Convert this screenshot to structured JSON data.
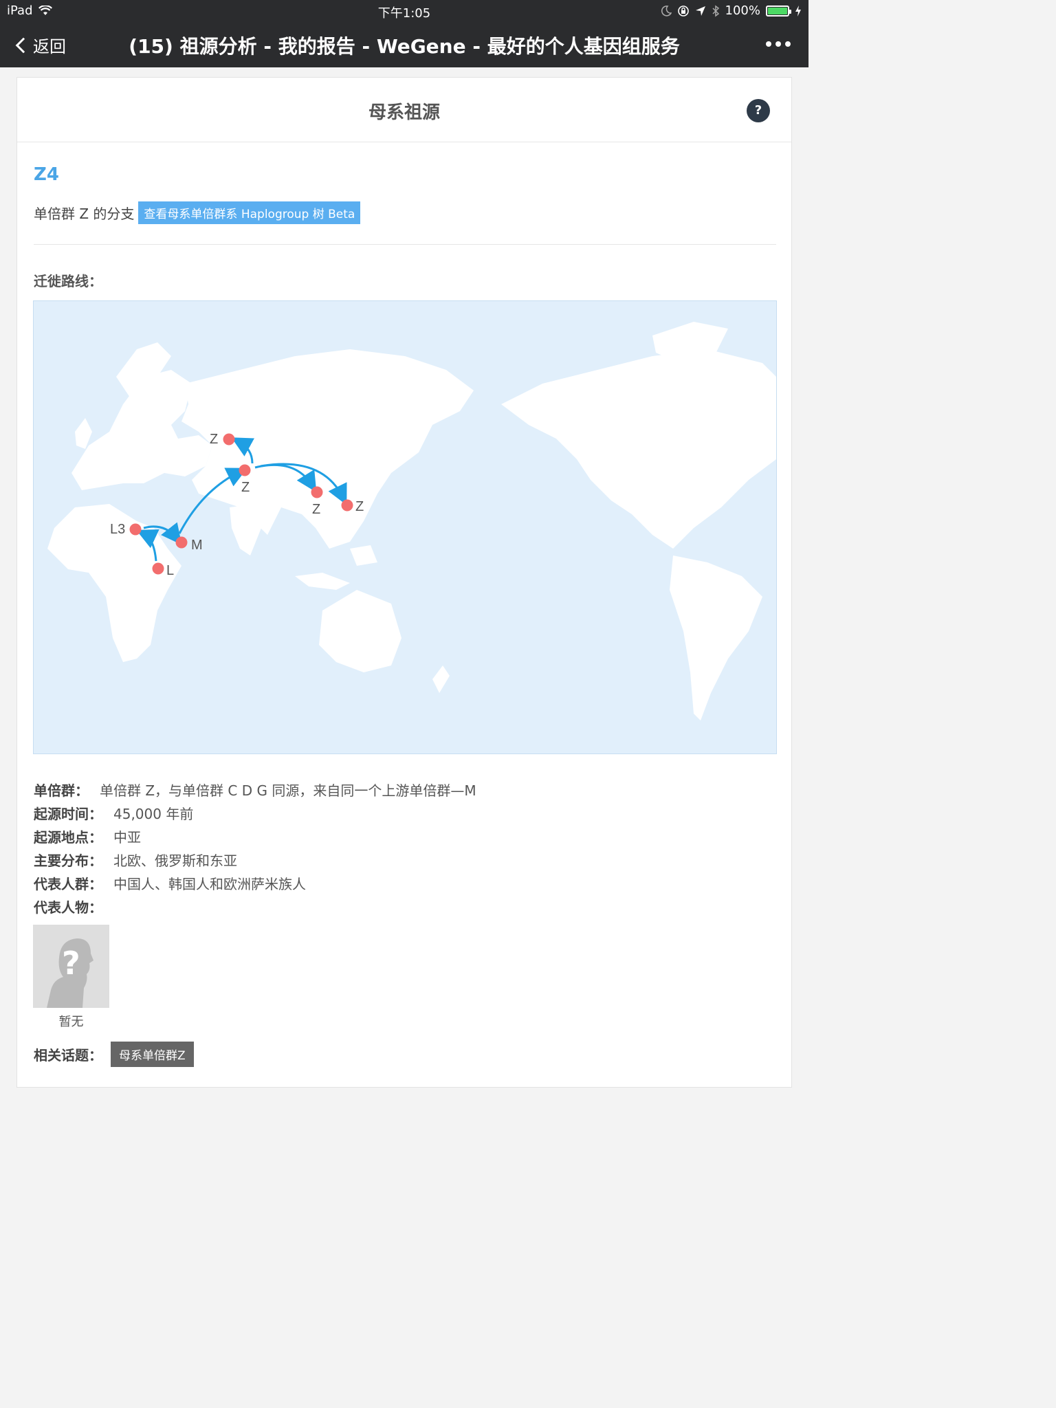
{
  "status": {
    "device": "iPad",
    "time": "下午1:05",
    "battery": "100%",
    "battery_level": 1.0
  },
  "nav": {
    "back_label": "返回",
    "title": "(15) 祖源分析 - 我的报告 - WeGene - 最好的个人基因组服务"
  },
  "card": {
    "title": "母系祖源",
    "help": "?",
    "haplogroup": "Z4",
    "branch_text": "单倍群 Z 的分支",
    "tree_link": "查看母系单倍群系 Haplogroup 树 Beta",
    "route_label": "迁徙路线："
  },
  "map": {
    "points": [
      {
        "label": "L"
      },
      {
        "label": "L3"
      },
      {
        "label": "M"
      },
      {
        "label": "Z"
      },
      {
        "label": "Z"
      },
      {
        "label": "Z"
      },
      {
        "label": "Z"
      }
    ],
    "colors": {
      "ocean": "#e1effb",
      "land": "#ffffff",
      "point": "#f26d6d",
      "arrow": "#1f9fe3"
    }
  },
  "info": {
    "haplogroup_key": "单倍群：",
    "haplogroup_val": "单倍群 Z，与单倍群 C D G 同源，来自同一个上游单倍群—M",
    "origin_time_key": "起源时间：",
    "origin_time_val": "45,000 年前",
    "origin_place_key": "起源地点：",
    "origin_place_val": "中亚",
    "distribution_key": "主要分布：",
    "distribution_val": "北欧、俄罗斯和东亚",
    "population_key": "代表人群：",
    "population_val": "中国人、韩国人和欧洲萨米族人",
    "figures_key": "代表人物："
  },
  "person": {
    "caption": "暂无"
  },
  "topics": {
    "label": "相关话题：",
    "tag": "母系单倍群Z"
  }
}
